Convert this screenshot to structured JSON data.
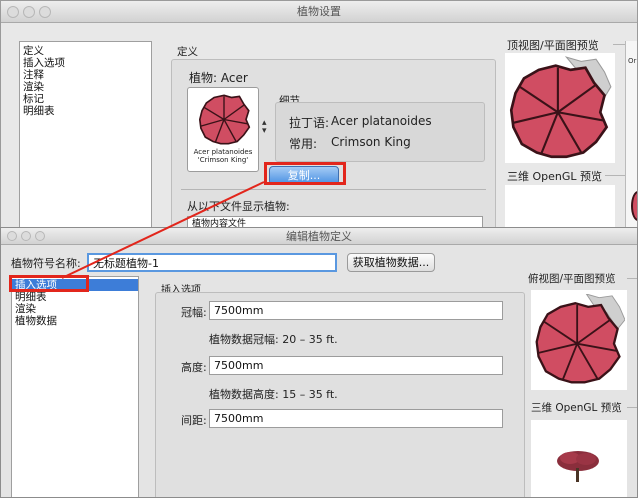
{
  "colors": {
    "accent_red": "#e2261c",
    "selection_blue": "#3d7dd8",
    "canopy_fill": "#d04d62"
  },
  "plant_settings": {
    "title": "植物设置",
    "list": [
      "定义",
      "插入选项",
      "注释",
      "渲染",
      "标记",
      "明细表"
    ],
    "section_title": "定义",
    "plant_label": "植物: Acer",
    "thumb_caption": "Acer platanoides\n'Crimson King'",
    "details_title": "细节",
    "latin_label": "拉丁语:",
    "latin_value": "Acer platanoides",
    "common_label": "常用:",
    "common_value": "Crimson King",
    "copy_button": "复制...",
    "show_from_file": "从以下文件显示植物:",
    "content_file": "植物内容文件",
    "top_preview": "顶视图/平面图预览",
    "opengl_preview": "三维 OpenGL 预览",
    "right_edge_text": "Or"
  },
  "edit_plant": {
    "title": "编辑植物定义",
    "symbol_label": "植物符号名称:",
    "symbol_value": "无标题植物-1",
    "fetch_button": "获取植物数据...",
    "list": [
      "插入选项",
      "明细表",
      "渲染",
      "植物数据"
    ],
    "section_title": "插入选项",
    "width_label": "冠幅:",
    "width_value": "7500mm",
    "width_info": "植物数据冠幅: 20 – 35 ft.",
    "height_label": "高度:",
    "height_value": "7500mm",
    "height_info": "植物数据高度: 15 – 35 ft.",
    "spacing_label": "间距:",
    "spacing_value": "7500mm",
    "top_preview": "俯视图/平面图预览",
    "opengl_preview": "三维 OpenGL 预览"
  }
}
